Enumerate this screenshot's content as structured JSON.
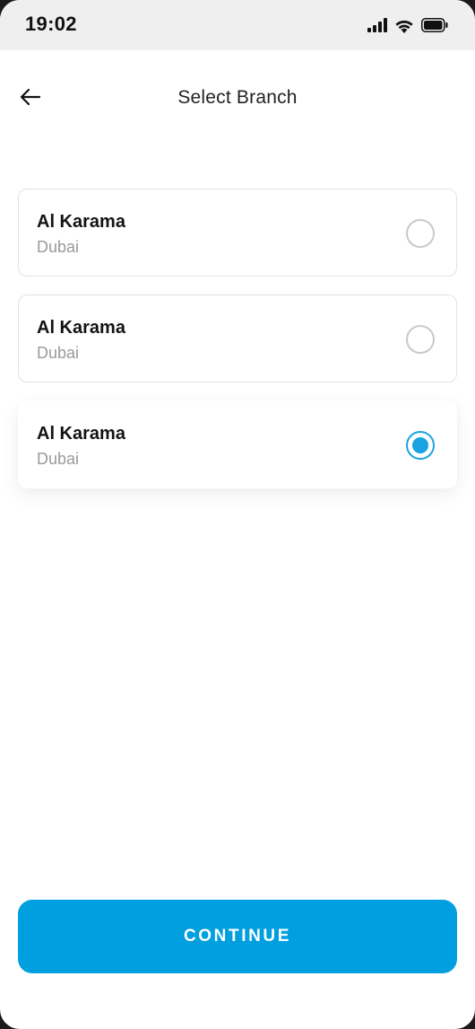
{
  "status_bar": {
    "time": "19:02",
    "icons": [
      "cellular-signal-icon",
      "wifi-icon",
      "battery-icon"
    ]
  },
  "header": {
    "back_icon": "arrow-left-icon",
    "title": "Select Branch"
  },
  "branches": [
    {
      "name": "Al Karama",
      "city": "Dubai",
      "selected": false
    },
    {
      "name": "Al Karama",
      "city": "Dubai",
      "selected": false
    },
    {
      "name": "Al Karama",
      "city": "Dubai",
      "selected": true
    }
  ],
  "actions": {
    "continue_label": "CONTINUE"
  },
  "colors": {
    "accent": "#009fe0",
    "radio_selected": "#1aa3e0",
    "status_bar_bg": "#efefef"
  }
}
